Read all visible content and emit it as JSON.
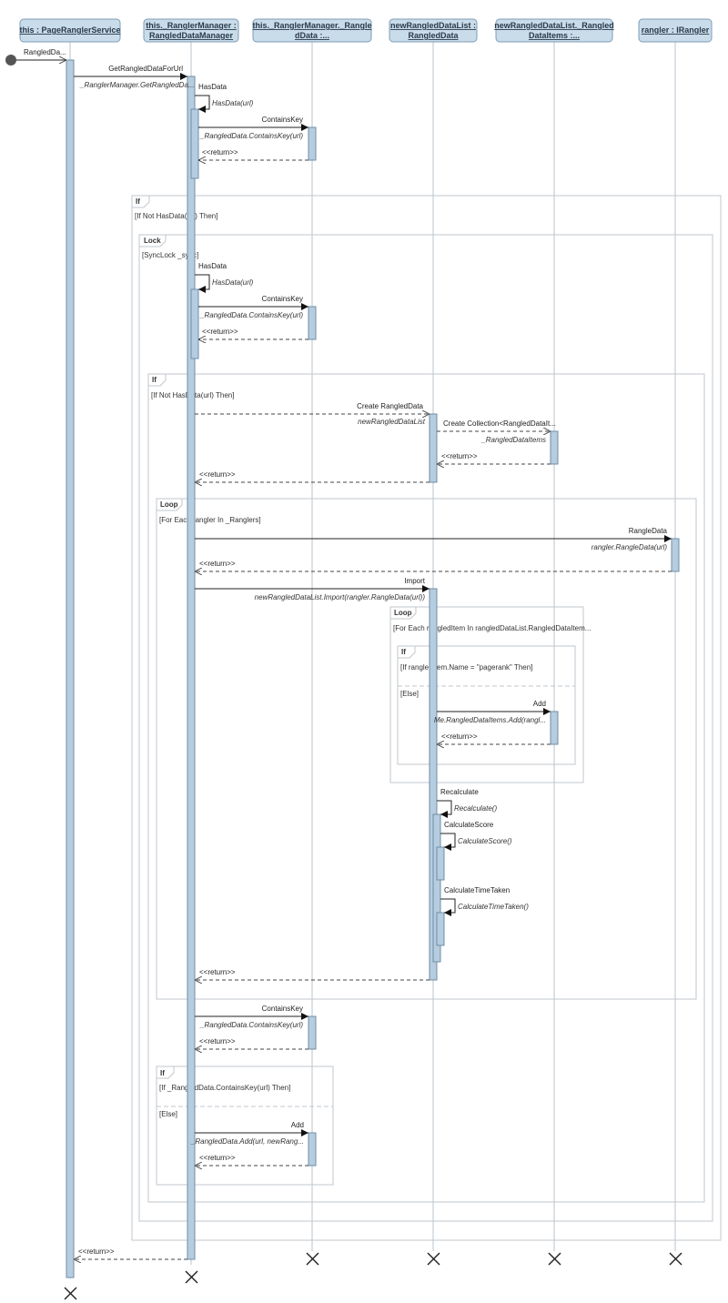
{
  "participants": [
    {
      "id": "svc",
      "line1": "this : PageRanglerService",
      "line2": ""
    },
    {
      "id": "mgr",
      "line1": "this._RanglerManager :",
      "line2": "RangledDataManager"
    },
    {
      "id": "rdata",
      "line1": "this._RanglerManager._Rangle",
      "line2": "dData :..."
    },
    {
      "id": "list",
      "line1": "newRangledDataList :",
      "line2": "RangledData"
    },
    {
      "id": "items",
      "line1": "newRangledDataList._Rangled",
      "line2": "DataItems :..."
    },
    {
      "id": "rangler",
      "line1": "rangler : IRangler",
      "line2": ""
    }
  ],
  "fragments": [
    {
      "op": "If",
      "guard": "[If Not HasData(url) Then]"
    },
    {
      "op": "Lock",
      "guard": "[SyncLock _sync]"
    },
    {
      "op": "If",
      "guard": "[If Not HasData(url) Then]"
    },
    {
      "op": "Loop",
      "guard": "[For Each rangler In _Ranglers]"
    },
    {
      "op": "Loop",
      "guard": "[For Each rangledItem In rangledDataList.RangledDataItem..."
    },
    {
      "op": "If",
      "guard": "[If rangledItem.Name = \"pagerank\" Then]",
      "else_guard": "[Else]"
    },
    {
      "op": "If",
      "guard": "[If _RangledData.ContainsKey(url) Then]",
      "else_guard": "[Else]"
    }
  ],
  "messages": [
    {
      "label": "RangledDa...",
      "sub": ""
    },
    {
      "label": "GetRangledDataForUrl",
      "sub": "_RanglerManager.GetRangledDa..."
    },
    {
      "label": "HasData",
      "sub": "HasData(url)"
    },
    {
      "label": "ContainsKey",
      "sub": "_RangledData.ContainsKey(url)"
    },
    {
      "label": "<<return>>",
      "sub": ""
    },
    {
      "label": "HasData",
      "sub": "HasData(url)"
    },
    {
      "label": "ContainsKey",
      "sub": "_RangledData.ContainsKey(url)"
    },
    {
      "label": "<<return>>",
      "sub": ""
    },
    {
      "label": "Create RangledData",
      "sub": "newRangledDataList"
    },
    {
      "label": "Create Collection<RangledDataIt...",
      "sub": "_RangledDataItems"
    },
    {
      "label": "<<return>>",
      "sub": ""
    },
    {
      "label": "<<return>>",
      "sub": ""
    },
    {
      "label": "RangleData",
      "sub": "rangler.RangleData(url)"
    },
    {
      "label": "<<return>>",
      "sub": ""
    },
    {
      "label": "Import",
      "sub": "newRangledDataList.Import(rangler.RangleData(url))"
    },
    {
      "label": "Add",
      "sub": "Me.RangledDataItems.Add(rangl..."
    },
    {
      "label": "<<return>>",
      "sub": ""
    },
    {
      "label": "Recalculate",
      "sub": "Recalculate()"
    },
    {
      "label": "CalculateScore",
      "sub": "CalculateScore()"
    },
    {
      "label": "CalculateTimeTaken",
      "sub": "CalculateTimeTaken()"
    },
    {
      "label": "<<return>>",
      "sub": ""
    },
    {
      "label": "ContainsKey",
      "sub": "_RangledData.ContainsKey(url)"
    },
    {
      "label": "<<return>>",
      "sub": ""
    },
    {
      "label": "Add",
      "sub": "_RangledData.Add(url, newRang..."
    },
    {
      "label": "<<return>>",
      "sub": ""
    },
    {
      "label": "<<return>>",
      "sub": ""
    }
  ]
}
